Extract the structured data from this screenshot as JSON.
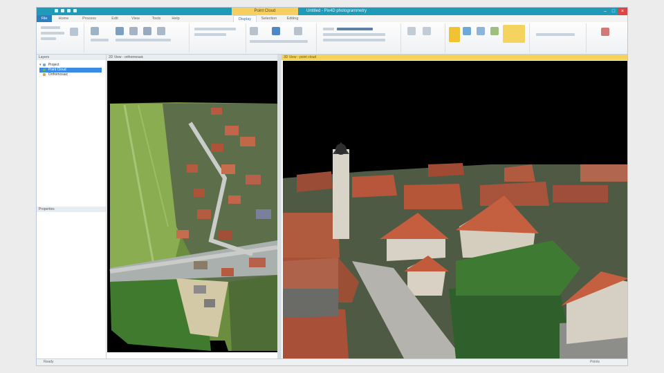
{
  "window": {
    "title": "Untitled - Pix4D photogrammetry"
  },
  "contextual_tab": {
    "label": "Point Cloud"
  },
  "tabs": [
    {
      "label": "File"
    },
    {
      "label": "Home"
    },
    {
      "label": "Process"
    },
    {
      "label": "Edit"
    },
    {
      "label": "View"
    },
    {
      "label": "Tools"
    },
    {
      "label": "Help"
    },
    {
      "label": "Display"
    },
    {
      "label": "Selection"
    },
    {
      "label": "Editing"
    }
  ],
  "panels": {
    "layers_title": "Layers",
    "properties_title": "Properties",
    "view_2d_title": "2D View - orthomosaic",
    "view_3d_title": "3D View - point cloud"
  },
  "tree": [
    {
      "label": "Project"
    },
    {
      "label": "Point Cloud"
    },
    {
      "label": "Orthomosaic"
    }
  ],
  "status": {
    "left": "Ready",
    "right": "Points"
  },
  "colors": {
    "title_bar": "#1f9bb7",
    "context_tab": "#f6cf5e",
    "selection": "#3b8be6",
    "viewport_bg": "#000000"
  },
  "icons": [
    "save-icon",
    "undo-icon",
    "redo-icon",
    "minimize-icon",
    "maximize-icon",
    "close-icon",
    "folder-icon",
    "cloud-icon"
  ]
}
